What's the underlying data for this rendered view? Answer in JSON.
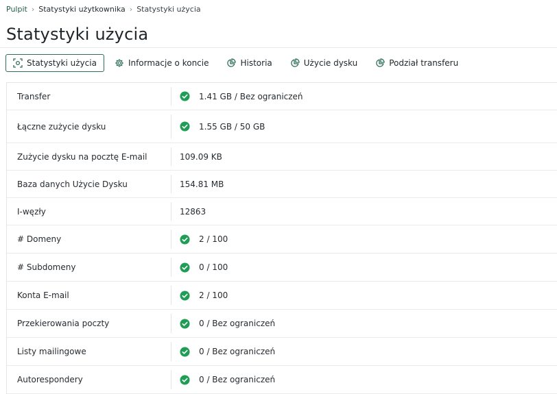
{
  "breadcrumb": {
    "items": [
      "Pulpit",
      "Statystyki użytkownika",
      "Statystyki użycia"
    ]
  },
  "page": {
    "title": "Statystyki użycia"
  },
  "tabs": [
    {
      "label": "Statystyki użycia",
      "icon": "stats-scan-icon",
      "active": true
    },
    {
      "label": "Informacje o koncie",
      "icon": "gear-icon",
      "active": false
    },
    {
      "label": "Historia",
      "icon": "pie-chart-icon",
      "active": false
    },
    {
      "label": "Użycie dysku",
      "icon": "pie-chart-icon",
      "active": false
    },
    {
      "label": "Podział transferu",
      "icon": "pie-chart-icon",
      "active": false
    }
  ],
  "stats": [
    {
      "label": "Transfer",
      "value": "1.41 GB / Bez ograniczeń",
      "ok": true
    },
    {
      "label": "Łączne zużycie dysku",
      "value": "1.55 GB / 50 GB",
      "ok": true
    },
    {
      "label": "Zużycie dysku na pocztę E-mail",
      "value": "109.09 KB",
      "ok": false
    },
    {
      "label": "Baza danych Użycie Dysku",
      "value": "154.81 MB",
      "ok": false
    },
    {
      "label": "I-węzły",
      "value": "12863",
      "ok": false
    },
    {
      "label": "# Domeny",
      "value": "2 / 100",
      "ok": true
    },
    {
      "label": "# Subdomeny",
      "value": "0 / 100",
      "ok": true
    },
    {
      "label": "Konta E-mail",
      "value": "2 / 100",
      "ok": true
    },
    {
      "label": "Przekierowania poczty",
      "value": "0 / Bez ograniczeń",
      "ok": true
    },
    {
      "label": "Listy mailingowe",
      "value": "0 / Bez ograniczeń",
      "ok": true
    },
    {
      "label": "Autorespondery",
      "value": "0 / Bez ograniczeń",
      "ok": true
    }
  ],
  "colors": {
    "accent": "#2e6e59",
    "success": "#1f9d55",
    "breadcrumb_link": "#1f5f4c"
  }
}
